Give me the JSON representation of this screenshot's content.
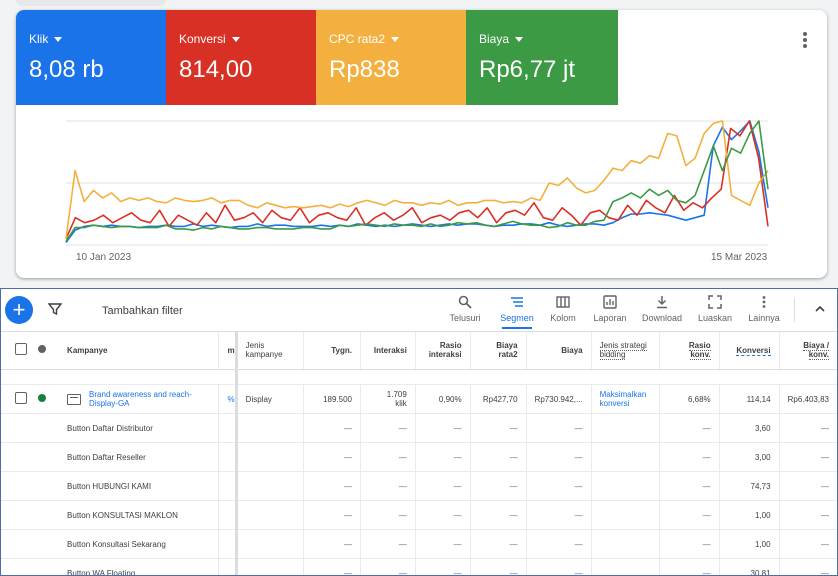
{
  "metrics": [
    {
      "label": "Klik",
      "value": "8,08 rb",
      "color": "#1a73e8"
    },
    {
      "label": "Konversi",
      "value": "814,00",
      "color": "#d93025"
    },
    {
      "label": "CPC rata2",
      "value": "Rp838",
      "color": "#f4b03e"
    },
    {
      "label": "Biaya",
      "value": "Rp6,77 jt",
      "color": "#3c9a45"
    }
  ],
  "chart_data": {
    "type": "line",
    "x_start": "10 Jan 2023",
    "x_end": "15 Mar 2023",
    "x_tick_labels": [
      "10 Jan 2023",
      "15 Mar 2023"
    ],
    "grid": true,
    "normalized_scale": true,
    "series": [
      {
        "metric": "Klik",
        "color": "#1a73e8",
        "values": [
          2,
          12,
          15,
          16,
          15,
          16,
          15,
          15,
          14,
          15,
          15,
          16,
          15,
          15,
          17,
          15,
          16,
          15,
          14,
          15,
          15,
          17,
          15,
          16,
          16,
          15,
          15,
          15,
          16,
          15,
          16,
          15,
          17,
          16,
          15,
          16,
          15,
          16,
          17,
          16,
          15,
          16,
          17,
          16,
          17,
          17,
          16,
          15,
          16,
          16,
          17,
          17,
          16,
          18,
          16,
          15,
          16,
          17,
          17,
          16,
          18,
          22,
          25,
          25,
          26,
          25,
          24,
          22,
          20,
          22,
          24,
          80,
          95,
          85,
          92,
          100,
          75,
          30
        ]
      },
      {
        "metric": "Konversi",
        "color": "#d93025",
        "values": [
          5,
          22,
          18,
          20,
          24,
          18,
          22,
          26,
          20,
          18,
          28,
          15,
          24,
          20,
          16,
          26,
          18,
          32,
          20,
          22,
          26,
          18,
          28,
          22,
          20,
          30,
          18,
          24,
          26,
          22,
          20,
          30,
          16,
          22,
          26,
          20,
          24,
          30,
          18,
          22,
          24,
          20,
          26,
          28,
          22,
          30,
          18,
          26,
          28,
          24,
          34,
          22,
          20,
          30,
          24,
          16,
          26,
          28,
          22,
          20,
          32,
          24,
          36,
          30,
          26,
          40,
          28,
          34,
          30,
          38,
          45,
          94,
          88,
          100,
          70,
          15
        ]
      },
      {
        "metric": "CPC rata2",
        "color": "#f4b03e",
        "values": [
          5,
          60,
          35,
          44,
          38,
          42,
          35,
          38,
          36,
          38,
          35,
          34,
          38,
          36,
          35,
          36,
          38,
          34,
          36,
          36,
          32,
          30,
          34,
          32,
          30,
          31,
          30,
          31,
          32,
          30,
          33,
          31,
          34,
          36,
          34,
          32,
          36,
          34,
          34,
          32,
          34,
          33,
          36,
          32,
          34,
          34,
          36,
          36,
          34,
          35,
          34,
          38,
          36,
          50,
          48,
          54,
          46,
          42,
          44,
          52,
          62,
          60,
          68,
          66,
          72,
          70,
          90,
          88,
          64,
          70,
          90,
          98,
          100,
          40,
          36,
          32,
          50,
          60
        ]
      },
      {
        "metric": "Biaya",
        "color": "#3c9a45",
        "values": [
          3,
          14,
          14,
          16,
          15,
          14,
          15,
          15,
          14,
          14,
          14,
          16,
          13,
          13,
          12,
          14,
          13,
          15,
          14,
          13,
          13,
          14,
          14,
          13,
          13,
          13,
          14,
          14,
          13,
          13,
          16,
          15,
          16,
          17,
          16,
          15,
          17,
          16,
          16,
          15,
          17,
          15,
          16,
          18,
          17,
          18,
          16,
          15,
          17,
          19,
          17,
          16,
          16,
          14,
          15,
          18,
          16,
          16,
          19,
          20,
          35,
          38,
          42,
          38,
          45,
          40,
          44,
          36,
          34,
          40,
          60,
          80,
          60,
          78,
          74,
          90,
          100,
          45
        ]
      }
    ]
  },
  "toolbar": {
    "add_label": "+",
    "filter_label": "Tambahkan filter",
    "tools": [
      {
        "label": "Telusuri",
        "icon": "search-icon"
      },
      {
        "label": "Segmen",
        "icon": "segment-icon",
        "active": true
      },
      {
        "label": "Kolom",
        "icon": "columns-icon"
      },
      {
        "label": "Laporan",
        "icon": "report-icon"
      },
      {
        "label": "Download",
        "icon": "download-icon"
      },
      {
        "label": "Luaskan",
        "icon": "expand-icon"
      },
      {
        "label": "Lainnya",
        "icon": "more-vert-icon"
      }
    ]
  },
  "table": {
    "headers": {
      "campaign": "Kampanye",
      "truncated": "m",
      "type": "Jenis kampanye",
      "impr": "Tygn.",
      "interactions": "Interaksi",
      "interaction_rate": "Rasio interaksi",
      "avg_cost": "Biaya rata2",
      "cost": "Biaya",
      "bid_strategy": "Jenis strategi bidding",
      "conv_rate": "Rasio konv.",
      "conversions": "Konversi",
      "cost_per_conv": "Biaya / konv."
    },
    "campaign_row": {
      "name": "Brand awareness and reach-Display-GA",
      "pct_fragment": "%",
      "type": "Display",
      "impr": "189.500",
      "interactions": "1.709 klik",
      "interaction_rate": "0,90%",
      "avg_cost": "Rp427,70",
      "cost": "Rp730.942,...",
      "bid_strategy": "Maksimalkan konversi",
      "conv_rate": "6,68%",
      "conversions": "114,14",
      "cost_per_conv": "Rp6.403,83"
    },
    "dash": "—",
    "conversion_rows": [
      {
        "name": "Button Daftar Distributor",
        "conversions": "3,60"
      },
      {
        "name": "Button Daftar Reseller",
        "conversions": "3,00"
      },
      {
        "name": "Button HUBUNGI KAMI",
        "conversions": "74,73"
      },
      {
        "name": "Button KONSULTASI MAKLON",
        "conversions": "1,00"
      },
      {
        "name": "Button Konsultasi Sekarang",
        "conversions": "1,00"
      },
      {
        "name": "Button WA Floating",
        "conversions": "30,81"
      }
    ]
  }
}
